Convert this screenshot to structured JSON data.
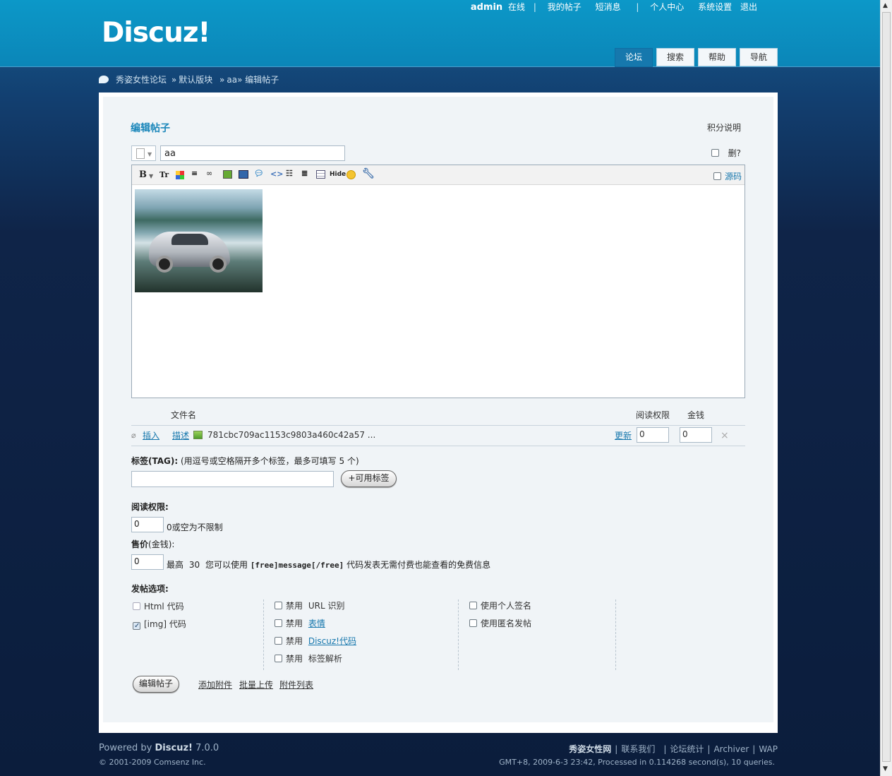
{
  "header": {
    "logo": "Discuz!",
    "user": {
      "name": "admin",
      "status": "在线"
    },
    "links": [
      "我的帖子",
      "短消息",
      "个人中心",
      "系统设置",
      "退出"
    ],
    "nav": [
      {
        "label": "论坛",
        "active": true
      },
      {
        "label": "搜索",
        "active": false
      },
      {
        "label": "帮助",
        "active": false
      },
      {
        "label": "导航",
        "active": false
      }
    ]
  },
  "breadcrumb": {
    "site": "秀姿女性论坛",
    "arrow": "»",
    "forum": "默认版块",
    "thread": "aa",
    "page": "编辑帖子"
  },
  "form": {
    "title": "编辑帖子",
    "credit_help": "积分说明",
    "subject_value": "aa",
    "delete_label": "删?",
    "source_label": "源码",
    "attachments": {
      "col_filename": "文件名",
      "col_readperm": "阅读权限",
      "col_price": "金钱",
      "item": {
        "insert": "插入",
        "describe": "描述",
        "filename": "781cbc709ac1153c9803a460c42a57 ...",
        "update": "更新",
        "readperm": "0",
        "price": "0",
        "remove": "×"
      }
    },
    "tags": {
      "label": "标签(TAG):",
      "hint": "(用逗号或空格隔开多个标签，最多可填写",
      "max": "5",
      "hint_tail": "个)",
      "value": "",
      "button": "+可用标签"
    },
    "readperm": {
      "label": "阅读权限:",
      "value": "0",
      "hint": "0或空为不限制"
    },
    "price": {
      "label": "售价",
      "unit": "(金钱):",
      "value": "0",
      "max_prefix": "最高",
      "max": "30",
      "hint1": "您可以使用",
      "code": "[free]message[/free]",
      "hint2": "代码发表无需付费也能查看的免费信息"
    },
    "options": {
      "label": "发帖选项:",
      "col1": [
        {
          "label": "Html 代码",
          "checked": false,
          "disabled": true
        },
        {
          "label": "[img] 代码",
          "checked": true,
          "disabled": true
        }
      ],
      "col2": [
        {
          "prefix": "禁用",
          "label": "URL 识别",
          "link": false
        },
        {
          "prefix": "禁用",
          "label": "表情",
          "link": true
        },
        {
          "prefix": "禁用",
          "label": "Discuz!代码",
          "link": true
        },
        {
          "prefix": "禁用",
          "label": "标签解析",
          "link": false
        }
      ],
      "col3": [
        {
          "label": "使用个人签名"
        },
        {
          "label": "使用匿名发帖"
        }
      ]
    },
    "submit": "编辑帖子",
    "links": [
      "添加附件",
      "批量上传",
      "附件列表"
    ]
  },
  "toolbar_icons": [
    "bold-icon",
    "font-size-icon",
    "color-icon",
    "align-icon",
    "link-icon",
    "image-icon",
    "media-icon",
    "quote-icon",
    "code-icon",
    "ordered-list-icon",
    "indent-icon",
    "table-icon",
    "hide-icon",
    "smiley-icon",
    "tools-icon"
  ],
  "footer": {
    "powered": "Powered by",
    "product": "Discuz!",
    "version": "7.0.0",
    "copyright": "© 2001-2009 Comsenz Inc.",
    "site": "秀姿女性网",
    "links": [
      "联系我们",
      "论坛统计",
      "Archiver",
      "WAP"
    ],
    "stats": "GMT+8, 2009-6-3 23:42, Processed in 0.114268 second(s), 10 queries."
  }
}
